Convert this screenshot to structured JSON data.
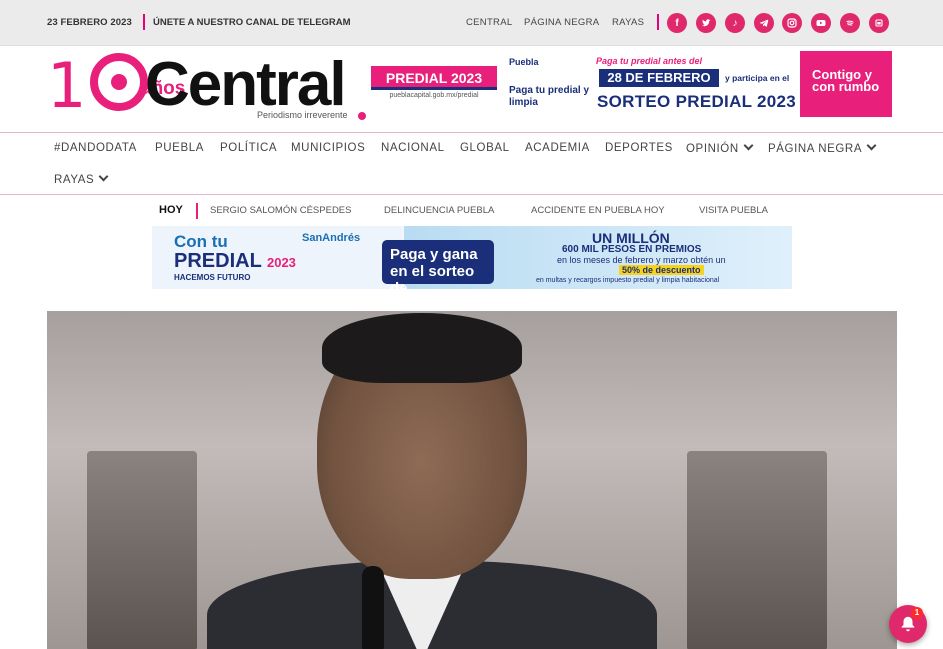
{
  "topbar": {
    "date": "23 FEBRERO 2023",
    "telegram": "ÚNETE A NUESTRO CANAL DE TELEGRAM",
    "links": [
      "CENTRAL",
      "PÁGINA NEGRA",
      "RAYAS"
    ],
    "social": [
      "facebook-icon",
      "twitter-icon",
      "tiktok-icon",
      "telegram-icon",
      "instagram-icon",
      "youtube-icon",
      "spotify-icon",
      "podcast-icon"
    ]
  },
  "logo": {
    "ten": "10",
    "anos": "años",
    "brand": "Central",
    "tagline": "Periodismo irreverente"
  },
  "header_ad": {
    "predial": "PREDIAL 2023",
    "url": "pueblacapital.gob.mx/predial",
    "puebla": "Puebla",
    "paga_limpia": "Paga tu predial y limpia",
    "paga_text": "Paga tu predial antes del",
    "feb": "28 DE FEBRERO",
    "participa": "y participa en el",
    "sorteo": "SORTEO PREDIAL 2023",
    "contigo": "Contigo y con rumbo"
  },
  "nav": {
    "items": [
      "#DANDODATA",
      "PUEBLA",
      "POLÍTICA",
      "MUNICIPIOS",
      "NACIONAL",
      "GLOBAL",
      "ACADEMIA",
      "DEPORTES",
      "OPINIÓN",
      "PÁGINA NEGRA",
      "RAYAS"
    ]
  },
  "trending": {
    "label": "HOY",
    "items": [
      "SERGIO SALOMÓN CÉSPEDES",
      "DELINCUENCIA PUEBLA",
      "ACCIDENTE EN PUEBLA HOY",
      "VISITA PUEBLA"
    ]
  },
  "banner": {
    "con": "Con tu",
    "predial": "PREDIAL",
    "year": "2023",
    "hacemos": "HACEMOS FUTURO",
    "sanandres": "SanAndrés",
    "pago": "Paga y gana en el sorteo de",
    "millon": "UN MILLÓN",
    "premios": "600 MIL PESOS EN PREMIOS",
    "meses": "en los meses de febrero y marzo obtén un",
    "desc": "50% de descuento",
    "multas": "en multas y recargos impuesto predial y limpia habitacional"
  },
  "notification": {
    "badge": "1"
  },
  "colors": {
    "accent": "#e0296b",
    "navy": "#1a2e7a"
  }
}
